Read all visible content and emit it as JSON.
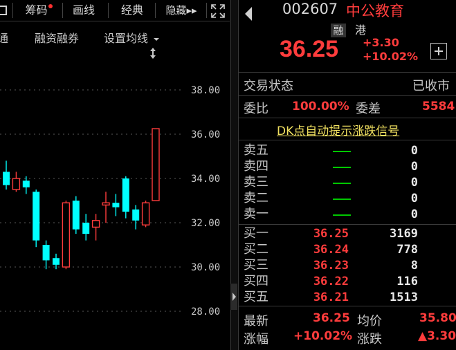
{
  "toolbar": {
    "items": [
      "筹码",
      "画线",
      "经典",
      "隐藏▸▸"
    ],
    "expand_icon": "expand-icon"
  },
  "subbar": {
    "items": [
      "通",
      "融资融券",
      "设置均线"
    ],
    "dropdown_icon": "caret-down-icon",
    "resize_icon": "updown-arrow-icon"
  },
  "chart_data": {
    "type": "candlestick",
    "y_ticks": [
      "38.00",
      "36.00",
      "34.00",
      "32.00",
      "30.00",
      "28.00"
    ],
    "ylim": [
      27.5,
      38.5
    ],
    "candles": [
      {
        "open": 34.3,
        "close": 33.7,
        "high": 34.8,
        "low": 33.5
      },
      {
        "open": 33.5,
        "close": 34.0,
        "high": 34.3,
        "low": 33.4
      },
      {
        "open": 33.9,
        "close": 33.6,
        "high": 34.1,
        "low": 33.3
      },
      {
        "open": 33.4,
        "close": 31.2,
        "high": 33.5,
        "low": 30.9
      },
      {
        "open": 31.0,
        "close": 30.3,
        "high": 31.2,
        "low": 29.9
      },
      {
        "open": 30.4,
        "close": 30.1,
        "high": 30.6,
        "low": 29.9
      },
      {
        "open": 30.0,
        "close": 32.9,
        "high": 33.0,
        "low": 29.9
      },
      {
        "open": 33.0,
        "close": 31.7,
        "high": 33.2,
        "low": 31.5
      },
      {
        "open": 32.0,
        "close": 31.5,
        "high": 32.4,
        "low": 31.2
      },
      {
        "open": 31.8,
        "close": 32.1,
        "high": 32.4,
        "low": 31.2
      },
      {
        "open": 32.8,
        "close": 32.9,
        "high": 33.4,
        "low": 32.0
      },
      {
        "open": 32.9,
        "close": 32.7,
        "high": 33.3,
        "low": 32.3
      },
      {
        "open": 34.0,
        "close": 32.5,
        "high": 34.1,
        "low": 32.2
      },
      {
        "open": 32.6,
        "close": 32.1,
        "high": 32.8,
        "low": 31.7
      },
      {
        "open": 31.9,
        "close": 32.9,
        "high": 33.0,
        "low": 31.8
      },
      {
        "open": 33.0,
        "close": 36.25,
        "high": 36.25,
        "low": 33.0
      }
    ]
  },
  "stock": {
    "code": "002607",
    "name": "中公教育",
    "tag1": "融",
    "tag2": "港",
    "price": "36.25",
    "change": "+3.30",
    "change_pct": "+10.02%",
    "add_icon": "plus-icon",
    "prev_icon": "left-arrow-icon"
  },
  "status": {
    "label": "交易状态",
    "value": "已收市"
  },
  "ratio": {
    "label1": "委比",
    "value1": "100.00%",
    "label2": "委差",
    "value2": "5584"
  },
  "signal_link": "DK点自动提示涨跌信号",
  "orderbook": {
    "sell": [
      {
        "label": "卖五",
        "price": "—",
        "vol": "0"
      },
      {
        "label": "卖四",
        "price": "—",
        "vol": "0"
      },
      {
        "label": "卖三",
        "price": "—",
        "vol": "0"
      },
      {
        "label": "卖二",
        "price": "—",
        "vol": "0"
      },
      {
        "label": "卖一",
        "price": "—",
        "vol": "0"
      }
    ],
    "buy": [
      {
        "label": "买一",
        "price": "36.25",
        "vol": "3169"
      },
      {
        "label": "买二",
        "price": "36.24",
        "vol": "778"
      },
      {
        "label": "买三",
        "price": "36.23",
        "vol": "8"
      },
      {
        "label": "买四",
        "price": "36.22",
        "vol": "116"
      },
      {
        "label": "买五",
        "price": "36.21",
        "vol": "1513"
      }
    ]
  },
  "quote": {
    "latest_label": "最新",
    "latest_value": "36.25",
    "avg_label": "均价",
    "avg_value": "35.80",
    "pct_label": "涨幅",
    "pct_value": "+10.02%",
    "chg_label": "涨跌",
    "chg_value": "▲3.30"
  },
  "colors": {
    "up": "#ff3c3c",
    "down": "#00ffff",
    "flat": "#00c800"
  }
}
